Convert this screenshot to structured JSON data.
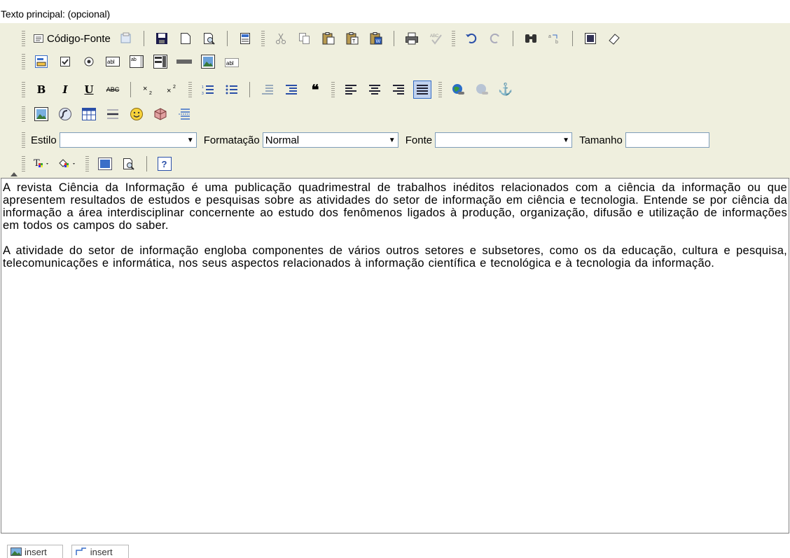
{
  "field": {
    "label": "Texto principal: (opcional)"
  },
  "toolbar": {
    "source_label": "Código-Fonte",
    "style_label": "Estilo",
    "style_value": "",
    "format_label": "Formatação",
    "format_value": "Normal",
    "font_label": "Fonte",
    "font_value": "",
    "size_label": "Tamanho",
    "size_value": "",
    "bold_glyph": "B",
    "italic_glyph": "I",
    "underline_glyph": "U",
    "strike_glyph": "ABC",
    "quote_glyph": "❝",
    "anchor_glyph": "⚓",
    "help_glyph": "?",
    "dropdown_arrow": "▼",
    "text_field_glyph": "abl",
    "textarea_glyph": "ab",
    "hidden_field_glyph": "abl",
    "spell_glyph": "ABC"
  },
  "editor": {
    "paragraphs": [
      "A revista Ciência da Informação é uma publicação quadrimestral de trabalhos inéditos relacionados com a ciência da informação ou que apresentem resultados de estudos e pesquisas sobre as atividades do setor de informação em ciência e tecnologia. Entende se por ciência da informação a área interdisciplinar concernente ao estudo dos fenômenos ligados à produção, organização, difusão e utilização de informações em todos os campos do saber.",
      "A atividade do setor de informação engloba componentes de vários outros setores e subsetores, como os da educação, cultura e pesquisa, telecomunicações e informática, nos seus aspectos relacionados à informação científica e tecnológica e à tecnologia da informação."
    ]
  },
  "bottom_tabs": [
    {
      "label": "insert"
    },
    {
      "label": "insert"
    }
  ],
  "colors": {
    "toolbar_bg": "#efefde",
    "active_bg": "#c1d2ee",
    "active_border": "#316ac5"
  }
}
